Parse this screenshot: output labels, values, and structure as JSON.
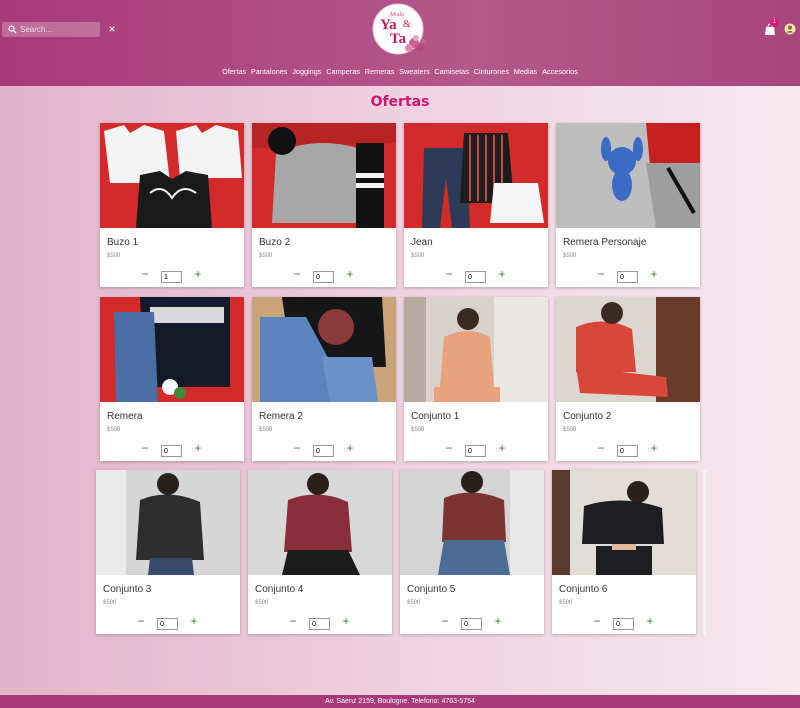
{
  "header": {
    "search_placeholder": "Search...",
    "clear_label": "×",
    "logo_text_small": "Moda",
    "logo_text_main": "Ya",
    "logo_text_amp": "&",
    "logo_text_main2": "Ta",
    "cart_count": "1"
  },
  "nav": [
    "Ofertas",
    "Pantalones",
    "Joggings",
    "Camperas",
    "Remeras",
    "Sweaters",
    "Camisetas",
    "Cinturones",
    "Medias",
    "Accesorios"
  ],
  "page_title": "Ofertas",
  "products": [
    {
      "name": "Buzo 1",
      "price": "$500",
      "qty": "1"
    },
    {
      "name": "Buzo 2",
      "price": "$500",
      "qty": "0"
    },
    {
      "name": "Jean",
      "price": "$500",
      "qty": "0"
    },
    {
      "name": "Remera Personaje",
      "price": "$500",
      "qty": "0"
    },
    {
      "name": "Remera",
      "price": "$500",
      "qty": "0"
    },
    {
      "name": "Remera 2",
      "price": "$500",
      "qty": "0"
    },
    {
      "name": "Conjunto 1",
      "price": "$500",
      "qty": "0"
    },
    {
      "name": "Conjunto 2",
      "price": "$500",
      "qty": "0"
    },
    {
      "name": "Conjunto 3",
      "price": "$500",
      "qty": "0"
    },
    {
      "name": "Conjunto 4",
      "price": "$500",
      "qty": "0"
    },
    {
      "name": "Conjunto 5",
      "price": "$500",
      "qty": "0"
    },
    {
      "name": "Conjunto 6",
      "price": "$500",
      "qty": "0"
    }
  ],
  "controls": {
    "minus": "−",
    "plus": "+"
  },
  "footer": "Av. Sáenz 2159, Boulogne. Telefono: 4763-5754",
  "colors": {
    "brand": "#a83a7a",
    "title": "#d1156f",
    "qty_buttons": "#3a7d2e",
    "badge": "#e0157a"
  }
}
